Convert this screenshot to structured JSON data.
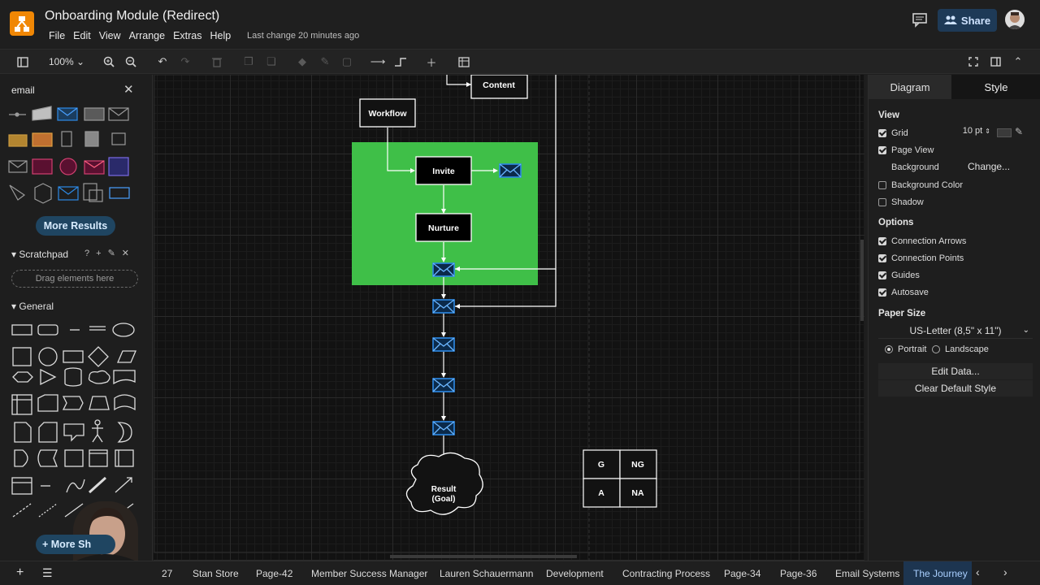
{
  "app": {
    "title": "Onboarding Module (Redirect)",
    "menu": [
      "File",
      "Edit",
      "View",
      "Arrange",
      "Extras",
      "Help"
    ],
    "last_change": "Last change 20 minutes ago",
    "share_label": "Share"
  },
  "toolbar": {
    "zoom": "100%"
  },
  "left_panel": {
    "search_value": "email",
    "more_results_label": "More Results",
    "scratchpad_label": "Scratchpad",
    "drag_hint": "Drag elements here",
    "general_label": "General",
    "more_shapes_label": "+ More Sh"
  },
  "diagram": {
    "nodes": {
      "content": "Content",
      "workflow": "Workflow",
      "invite": "Invite",
      "nurture": "Nurture",
      "result_line1": "Result",
      "result_line2": "(Goal)"
    },
    "matrix": [
      "G",
      "NG",
      "A",
      "NA"
    ],
    "group_color": "#3fbf48"
  },
  "right_panel": {
    "tabs": [
      "Diagram",
      "Style"
    ],
    "view_label": "View",
    "grid_label": "Grid",
    "grid_size": "10 pt",
    "page_view_label": "Page View",
    "background_label": "Background",
    "change_label": "Change...",
    "background_color_label": "Background Color",
    "shadow_label": "Shadow",
    "options_label": "Options",
    "connection_arrows_label": "Connection Arrows",
    "connection_points_label": "Connection Points",
    "guides_label": "Guides",
    "autosave_label": "Autosave",
    "paper_size_label": "Paper Size",
    "paper_size_value": "US-Letter (8,5\" x 11\")",
    "portrait_label": "Portrait",
    "landscape_label": "Landscape",
    "edit_data_label": "Edit Data...",
    "clear_style_label": "Clear Default Style"
  },
  "pages": {
    "tabs": [
      "27",
      "Stan Store",
      "Page-42",
      "Member Success Manager",
      "Lauren Schauermann",
      "Development",
      "Contracting Process",
      "Page-34",
      "Page-36",
      "Email Systems",
      "The Journey"
    ],
    "active": "The Journey"
  },
  "colors": {
    "accent": "#1d3550",
    "email_icon": "#2d8ae6",
    "logo": "#f08705"
  }
}
